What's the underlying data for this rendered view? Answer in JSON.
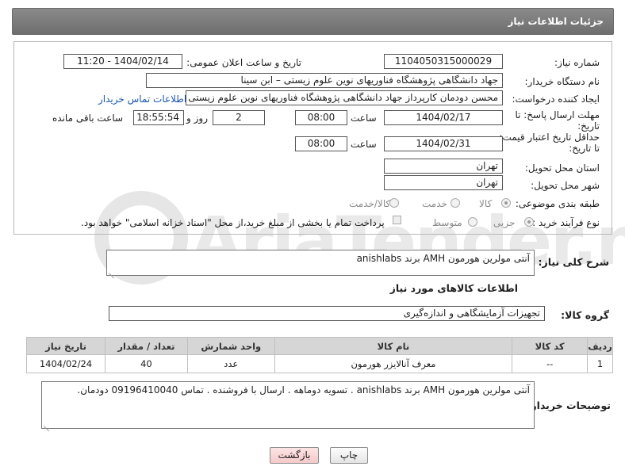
{
  "header": {
    "title": "جزئیات اطلاعات نیاز"
  },
  "need": {
    "number_label": "شماره نیاز:",
    "number": "1104050315000029",
    "announce_label": "تاریخ و ساعت اعلان عمومی:",
    "announce_value": "1404/02/14 - 11:20",
    "buyer_label": "نام دستگاه خریدار:",
    "buyer": "جهاد دانشگاهی پژوهشگاه فناوریهای نوین علوم زیستی – ابن سینا",
    "creator_label": "ایجاد کننده درخواست:",
    "creator": "محسن دودمان کارپرداز جهاد دانشگاهی پژوهشگاه فناوریهای نوین علوم زیستی",
    "contact_link": "اطلاعات تماس خریدار",
    "deadline_label_1": "مهلت ارسال پاسخ: تا",
    "deadline_label_2": "تاریخ:",
    "deadline_date": "1404/02/17",
    "hour_label": "ساعت",
    "deadline_hour": "08:00",
    "days": "2",
    "days_label": "روز و",
    "remaining_time": "18:55:54",
    "remaining_label": "ساعت باقی مانده",
    "validity_label_1": "حداقل تاریخ اعتبار قیمت:",
    "validity_label_2": "تا تاریخ:",
    "validity_date": "1404/02/31",
    "validity_hour": "08:00",
    "province_label": "استان محل تحویل:",
    "province": "تهران",
    "city_label": "شهر محل تحویل:",
    "city": "تهران",
    "category_label": "طبقه بندی موضوعی:",
    "category_options": [
      "کالا",
      "خدمت",
      "کالا/خدمت"
    ],
    "process_label": "نوع فرآیند خرید :",
    "process_options": [
      "جزیی",
      "متوسط"
    ],
    "payment_note": "پرداخت تمام یا بخشی از مبلغ خرید،از محل \"اسناد خزانه اسلامی\" خواهد بود."
  },
  "summary": {
    "label": "شرح کلی نیاز:",
    "value": "آنتی مولرین هورمون AMH برند anishlabs"
  },
  "goods": {
    "section_title": "اطلاعات کالاهای مورد نیاز",
    "group_label": "گروه کالا:",
    "group_value": "تجهیزات آزمایشگاهی و اندازه‌گیری",
    "columns": [
      "ردیف",
      "کد کالا",
      "نام کالا",
      "واحد شمارش",
      "تعداد / مقدار",
      "تاریخ نیاز"
    ],
    "rows": [
      {
        "row": "1",
        "code": "--",
        "name": "معرف آنالایزر هورمون",
        "unit": "عدد",
        "qty": "40",
        "date": "1404/02/24"
      }
    ]
  },
  "buyer_notes": {
    "label": "توضیحات خریدار:",
    "value": "آنتی مولرین هورمون AMH برند anishlabs . تسویه دوماهه . ارسال با فروشنده . تماس 09196410040 دودمان."
  },
  "buttons": {
    "print": "چاپ",
    "back": "بازگشت"
  },
  "watermark": {
    "text": "AriaTender.net"
  }
}
